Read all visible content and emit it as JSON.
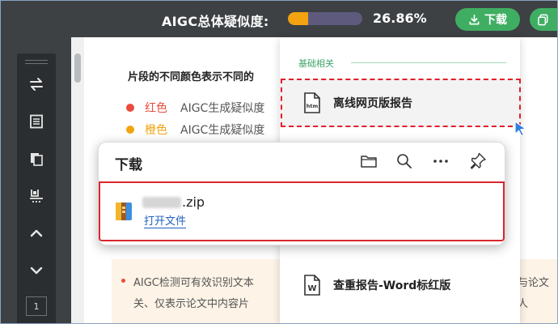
{
  "topbar": {
    "similarity_label": "AIGC总体疑似度:",
    "similarity_percent": "26.86%",
    "similarity_fraction": 0.2686,
    "download_label": "下载",
    "accent_color": "#3fae62",
    "progress_color": "#f2a30f"
  },
  "sidebar": {
    "tools": [
      "swap-icon",
      "outline-icon",
      "copy-pages-icon",
      "scan-icon",
      "chevron-up-icon",
      "chevron-down-icon"
    ],
    "page_number": "1"
  },
  "document": {
    "heading": "片段的不同颜色表示不同的",
    "legend": [
      {
        "color_name": "红色",
        "text": "AIGC生成疑似度",
        "dot": "#e94b3c",
        "text_color": "#e94b3c"
      },
      {
        "color_name": "橙色",
        "text": "AIGC生成疑似度",
        "dot": "#f2a30f",
        "text_color": "#f2a30f"
      }
    ],
    "notice_line1": "AIGC检测可有效识别文本",
    "notice_line2": "关、仅表示论文中内容片",
    "notice_right1": "与论文",
    "notice_right2": "人"
  },
  "menu": {
    "section_title": "基础相关",
    "items": [
      {
        "label": "离线网页版报告",
        "icon": "htm-file-icon",
        "icon_text": "htm"
      },
      {
        "label": "查重报告-Word标红版",
        "icon": "word-file-icon",
        "icon_text": "W"
      }
    ]
  },
  "download_popup": {
    "title": "下载",
    "actions": [
      "folder-icon",
      "search-icon",
      "more-icon",
      "pin-icon"
    ],
    "file_suffix": ".zip",
    "open_file_label": "打开文件"
  }
}
